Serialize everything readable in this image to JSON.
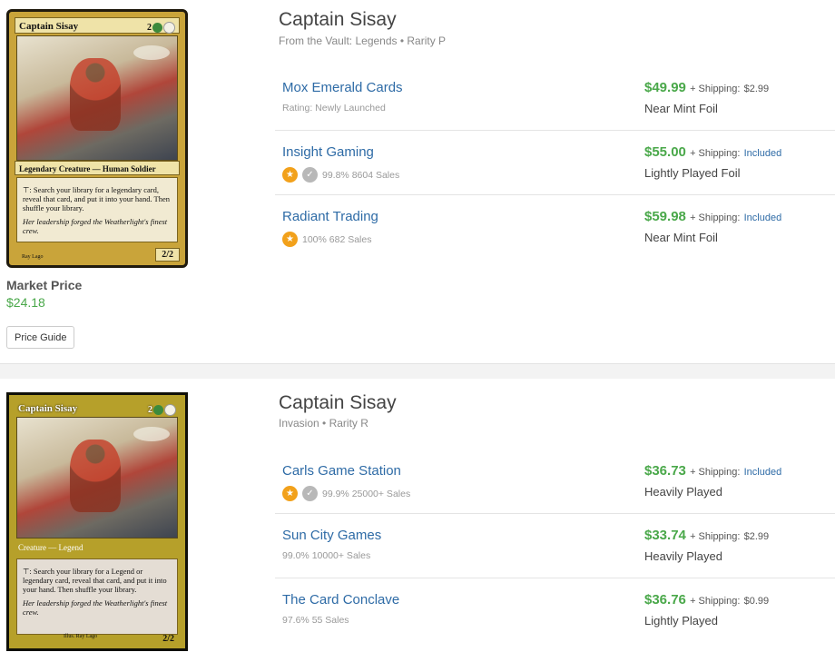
{
  "products": [
    {
      "title": "Captain Sisay",
      "subtitle": "From the Vault: Legends • Rarity P",
      "card": {
        "name": "Captain Sisay",
        "mana": "2",
        "type_line": "Legendary Creature — Human Soldier",
        "rules_text": ": Search your library for a legendary card, reveal that card, and put it into your hand. Then shuffle your library.",
        "flavor": "Her leadership forged the Weatherlight's finest crew.",
        "pt": "2/2",
        "illus": "Ray Lago"
      },
      "market_label": "Market Price",
      "market_price": "$24.18",
      "price_guide_label": "Price Guide",
      "listings": [
        {
          "seller": "Mox Emerald Cards",
          "meta": "Rating: Newly Launched",
          "badges": [],
          "price": "$49.99",
          "ship_label": "+ Shipping:",
          "ship": "$2.99",
          "ship_included": false,
          "condition": "Near Mint Foil"
        },
        {
          "seller": "Insight Gaming",
          "meta": "99.8% 8604 Sales",
          "badges": [
            "gold",
            "check"
          ],
          "price": "$55.00",
          "ship_label": "+ Shipping:",
          "ship": "Included",
          "ship_included": true,
          "condition": "Lightly Played Foil"
        },
        {
          "seller": "Radiant Trading",
          "meta": "100% 682 Sales",
          "badges": [
            "gold"
          ],
          "price": "$59.98",
          "ship_label": "+ Shipping:",
          "ship": "Included",
          "ship_included": true,
          "condition": "Near Mint Foil"
        }
      ]
    },
    {
      "title": "Captain Sisay",
      "subtitle": "Invasion • Rarity R",
      "card": {
        "name": "Captain Sisay",
        "mana": "2",
        "type_line": "Creature — Legend",
        "rules_text": ": Search your library for a Legend or legendary card, reveal that card, and put it into your hand. Then shuffle your library.",
        "flavor": "Her leadership forged the Weatherlight's finest crew.",
        "pt": "2/2",
        "illus": "Illus. Ray Lago"
      },
      "listings": [
        {
          "seller": "Carls Game Station",
          "meta": "99.9% 25000+ Sales",
          "badges": [
            "gold",
            "check"
          ],
          "price": "$36.73",
          "ship_label": "+ Shipping:",
          "ship": "Included",
          "ship_included": true,
          "condition": "Heavily Played"
        },
        {
          "seller": "Sun City Games",
          "meta": "99.0% 10000+ Sales",
          "badges": [],
          "price": "$33.74",
          "ship_label": "+ Shipping:",
          "ship": "$2.99",
          "ship_included": false,
          "condition": "Heavily Played"
        },
        {
          "seller": "The Card Conclave",
          "meta": "97.6% 55 Sales",
          "badges": [],
          "price": "$36.76",
          "ship_label": "+ Shipping:",
          "ship": "$0.99",
          "ship_included": false,
          "condition": "Lightly Played"
        }
      ]
    }
  ],
  "colors": {
    "price_green": "#4aa84a",
    "link_blue": "#2e6ba6",
    "badge_gold": "#f2a11b",
    "badge_check": "#b8b8b8"
  }
}
